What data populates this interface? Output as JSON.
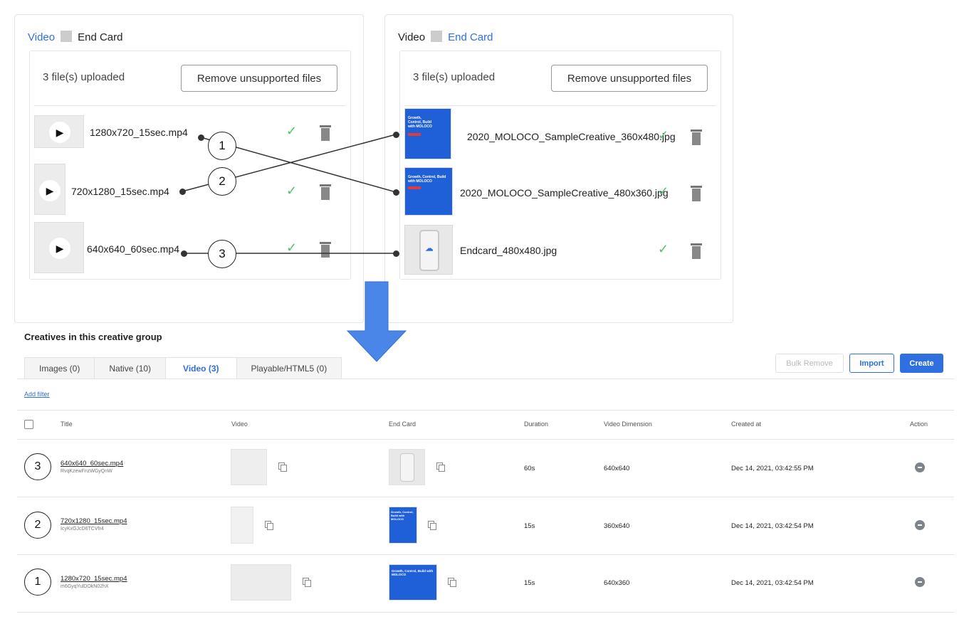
{
  "left_panel": {
    "tabs": [
      "Video",
      "End Card"
    ],
    "uploaded_text": "3 file(s) uploaded",
    "remove_btn": "Remove unsupported files",
    "files": [
      "1280x720_15sec.mp4",
      "720x1280_15sec.mp4",
      "640x640_60sec.mp4"
    ]
  },
  "right_panel": {
    "tabs": [
      "Video",
      "End Card"
    ],
    "uploaded_text": "3 file(s) uploaded",
    "remove_btn": "Remove unsupported files",
    "files": [
      "2020_MOLOCO_SampleCreative_360x480.jpg",
      "2020_MOLOCO_SampleCreative_480x360.jpg",
      "Endcard_480x480.jpg"
    ]
  },
  "callouts": [
    "1",
    "2",
    "3"
  ],
  "thumb_text": {
    "creative": "Growth, Control, Build with MOLOCO",
    "logo": "MOLOCO"
  },
  "section": {
    "title": "Creatives in this creative group",
    "tabs": [
      "Images (0)",
      "Native (10)",
      "Video (3)",
      "Playable/HTML5 (0)"
    ],
    "active_tab": "Video (3)",
    "add_filter": "Add filter",
    "buttons": {
      "bulk_remove": "Bulk Remove",
      "import": "Import",
      "create": "Create"
    }
  },
  "table": {
    "headers": {
      "title": "Title",
      "video": "Video",
      "end_card": "End Card",
      "duration": "Duration",
      "dimension": "Video Dimension",
      "created_at": "Created at",
      "action": "Action"
    },
    "rows": [
      {
        "num": "3",
        "title": "640x640_60sec.mp4",
        "id": "RvqKzewFnzWGyQnW",
        "duration": "60s",
        "dimension": "640x640",
        "created": "Dec 14, 2021, 03:42:55 PM"
      },
      {
        "num": "2",
        "title": "720x1280_15sec.mp4",
        "id": "IcyKxGJcD6TCVfr4",
        "duration": "15s",
        "dimension": "360x640",
        "created": "Dec 14, 2021, 03:42:54 PM"
      },
      {
        "num": "1",
        "title": "1280x720_15sec.mp4",
        "id": "m6GyqYulDOkN02hX",
        "duration": "15s",
        "dimension": "640x360",
        "created": "Dec 14, 2021, 03:42:54 PM"
      }
    ]
  },
  "colors": {
    "accent": "#2f6fe0",
    "check": "#55c26a",
    "arrow": "#4a86e8"
  }
}
